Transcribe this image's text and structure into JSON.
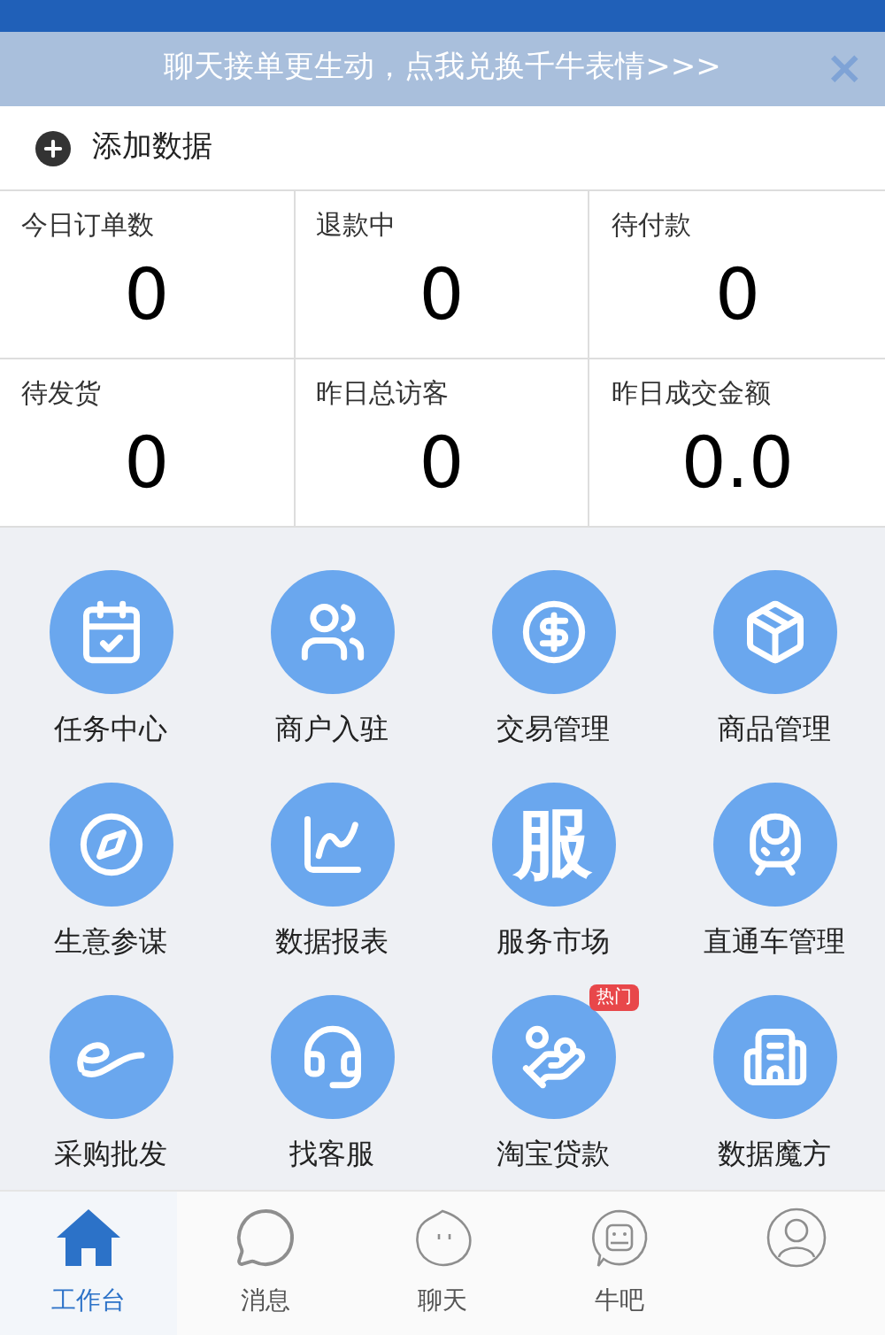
{
  "banner": {
    "text": "聊天接单更生动，点我兑换千牛表情>>>",
    "close": "×"
  },
  "add_data": {
    "label": "添加数据"
  },
  "stats": [
    {
      "label": "今日订单数",
      "value": "0"
    },
    {
      "label": "退款中",
      "value": "0"
    },
    {
      "label": "待付款",
      "value": "0"
    },
    {
      "label": "待发货",
      "value": "0"
    },
    {
      "label": "昨日总访客",
      "value": "0"
    },
    {
      "label": "昨日成交金额",
      "value": "0.0"
    }
  ],
  "apps": [
    {
      "label": "任务中心"
    },
    {
      "label": "商户入驻"
    },
    {
      "label": "交易管理"
    },
    {
      "label": "商品管理"
    },
    {
      "label": "生意参谋"
    },
    {
      "label": "数据报表"
    },
    {
      "label": "服务市场",
      "icon_text": "服"
    },
    {
      "label": "直通车管理"
    },
    {
      "label": "采购批发"
    },
    {
      "label": "找客服"
    },
    {
      "label": "淘宝贷款",
      "badge": "热门"
    },
    {
      "label": "数据魔方"
    }
  ],
  "tabs": [
    {
      "label": "工作台",
      "selected": true
    },
    {
      "label": "消息",
      "selected": false
    },
    {
      "label": "聊天",
      "selected": false
    },
    {
      "label": "牛吧",
      "selected": false
    },
    {
      "selected": false
    }
  ]
}
